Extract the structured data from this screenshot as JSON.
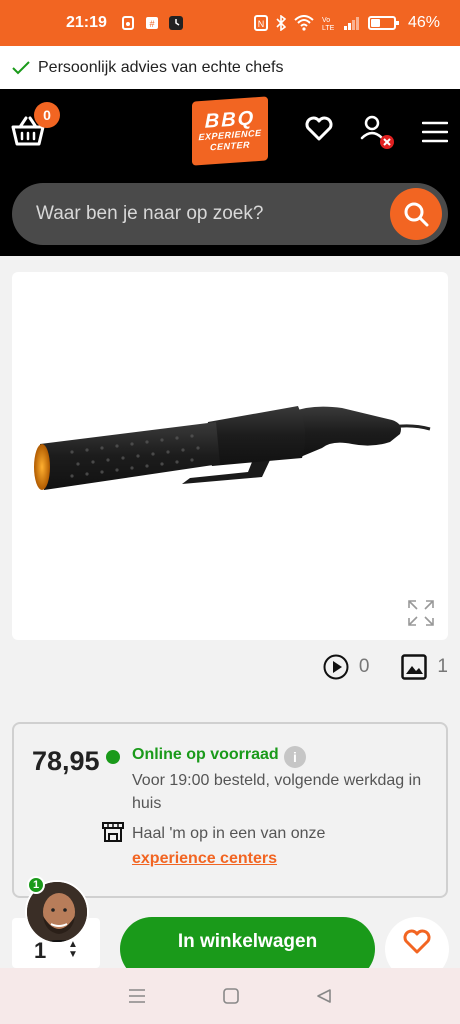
{
  "status_bar": {
    "time": "21:19",
    "battery": "46%",
    "battery_level": 0.46
  },
  "promo": {
    "text": "Persoonlijk advies van echte chefs",
    "icon": "check-icon"
  },
  "header": {
    "cart_count": "0",
    "logo_line1": "BBQ",
    "logo_line2": "EXPERIENCE",
    "logo_line3": "CENTER",
    "icons": [
      "basket-icon",
      "heart-icon",
      "user-icon",
      "menu-icon"
    ]
  },
  "search": {
    "placeholder": "Waar ben je naar op zoek?"
  },
  "media": {
    "video_count": "0",
    "image_count": "1"
  },
  "stock": {
    "price": "78,95",
    "status": "Online op voorraad",
    "delivery": "Voor 19:00 besteld, volgende werkdag in huis",
    "pickup": "Haal 'm op in een van onze",
    "link": "experience centers",
    "info_icon": "i"
  },
  "purchase": {
    "quantity": "1",
    "add_to_cart": "In winkelwagen",
    "chat_badge": "1"
  },
  "colors": {
    "brand": "#f26522",
    "stock_green": "#1a9a1a",
    "header_bg": "#000000"
  }
}
